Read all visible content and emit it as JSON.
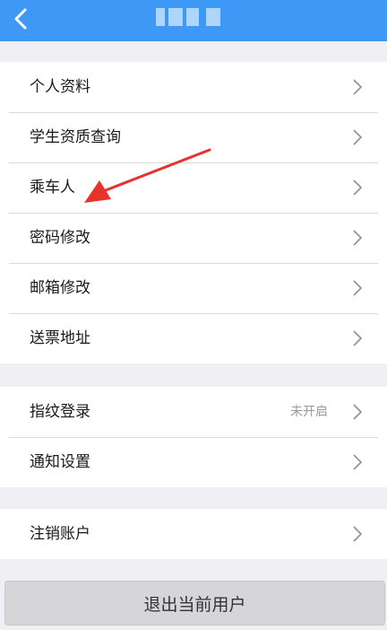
{
  "header": {
    "back_icon": "chevron-left-icon",
    "title": ""
  },
  "groups": [
    {
      "items": [
        {
          "label": "个人资料"
        },
        {
          "label": "学生资质查询"
        },
        {
          "label": "乘车人"
        },
        {
          "label": "密码修改"
        },
        {
          "label": "邮箱修改"
        },
        {
          "label": "送票地址"
        }
      ]
    },
    {
      "items": [
        {
          "label": "指纹登录",
          "value": "未开启"
        },
        {
          "label": "通知设置"
        }
      ]
    },
    {
      "items": [
        {
          "label": "注销账户"
        }
      ]
    }
  ],
  "logout_label": "退出当前用户",
  "colors": {
    "header": "#3d99f5",
    "background": "#efeff4",
    "annotation_arrow": "#e8332a"
  }
}
